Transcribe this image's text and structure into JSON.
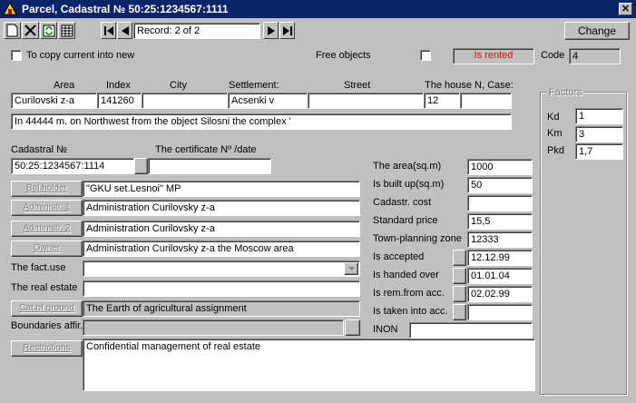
{
  "window": {
    "title": "Parcel, Cadastral № 50:25:1234567:1111",
    "close": "✕"
  },
  "toolbar": {
    "record": "Record: 2 of 2",
    "change": "Change"
  },
  "options": {
    "copy_current": "To copy current into new",
    "free_objects": "Free objects",
    "is_rented": "Is rented",
    "code_label": "Code",
    "code_value": "4"
  },
  "address": {
    "area_label": "Area",
    "index_label": "Index",
    "city_label": "City",
    "settlement_label": "Settlement:",
    "street_label": "Street",
    "house_label": "The house N, Case:",
    "area": "Curilovski  z-a",
    "index": "141260",
    "city": "",
    "settlement": "Acsenki  v",
    "street": "",
    "house": "12",
    "case": "",
    "description": "In 44444 m. on Northwest from the object Silosni the complex '"
  },
  "cadastral": {
    "label": "Cadastral №",
    "value": "50:25:1234567:1114",
    "cert_label": "The certificate Nº /date",
    "cert_value": ""
  },
  "left": {
    "bal_holder_btn": "Bal.holder",
    "bal_holder": "\"GKU set.Lesnoi\" MP",
    "admin1_btn": "Administr. 1",
    "admin1": "Administration Curilovsky z-a",
    "admin2_btn": "Administr. 2",
    "admin2": "Administration Curilovsky z-a",
    "owner_btn": "Owner",
    "owner": "Administration Curilovsky z-a the Moscow area",
    "fact_use_label": "The fact.use",
    "fact_use": "",
    "real_estate_label": "The real estate",
    "real_estate": "",
    "cat_ground_btn": "Cat.of ground",
    "cat_ground": "The Earth of agricultural assignment",
    "boundaries_label": "Boundaries affir.",
    "boundaries": "",
    "restrictions_btn": "Restrictions",
    "restrictions": "Confidential management of real estate"
  },
  "right": {
    "area_label": "The area(sq.m)",
    "area": "1000",
    "built_label": "Is built up(sq.m)",
    "built": "50",
    "cost_label": "Cadastr. cost",
    "cost": "",
    "std_price_label": "Standard price",
    "std_price": "15,5",
    "zone_label": "Town-planning zone",
    "zone": "12333",
    "accepted_label": "Is accepted",
    "accepted": "12.12.99",
    "handed_label": "Is handed over",
    "handed": "01.01.04",
    "remfrom_label": "Is rem.from acc.",
    "remfrom": "02.02.99",
    "taken_label": "Is taken into acc.",
    "taken": "",
    "inon_label": "INON",
    "inon": ""
  },
  "factors": {
    "title": "Factors",
    "kd_label": "Kd",
    "kd": "1",
    "km_label": "Km",
    "km": "3",
    "pkd_label": "Pkd",
    "pkd": "1,7"
  }
}
